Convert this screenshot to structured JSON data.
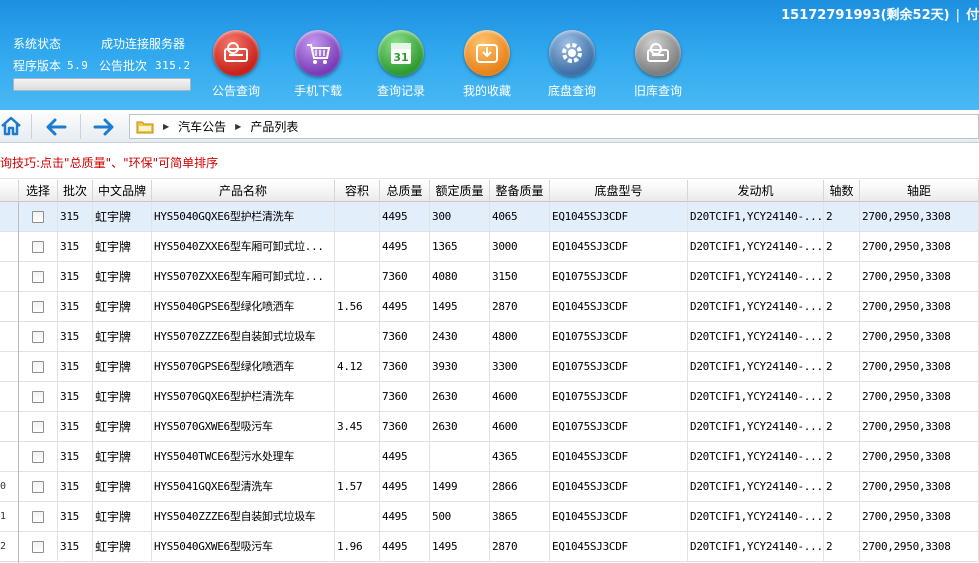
{
  "header": {
    "account": "15172791993(剩余52天)",
    "separator": "|",
    "account_extra": "付",
    "status": {
      "label1": "系统状态",
      "value1": "成功连接服务器",
      "label2": "程序版本",
      "version": "5.9",
      "label3": "公告批次",
      "batch": "315.2"
    },
    "progress": 1.0,
    "toolbar": [
      {
        "label": "公告查询",
        "icon": "announcement-search-icon",
        "color": "#d8342c"
      },
      {
        "label": "手机下载",
        "icon": "cart-download-icon",
        "color": "#8a4cc0"
      },
      {
        "label": "查询记录",
        "icon": "calendar-record-icon",
        "color": "#3aa63a"
      },
      {
        "label": "我的收藏",
        "icon": "favorites-inbox-icon",
        "color": "#f08c1c"
      },
      {
        "label": "底盘查询",
        "icon": "gear-chassis-icon",
        "color": "#4d7fb4"
      },
      {
        "label": "旧库查询",
        "icon": "old-archive-icon",
        "color": "#8c8c8c"
      }
    ],
    "calendar_day": "31"
  },
  "nav": {
    "crumbs": [
      "汽车公告",
      "产品列表"
    ]
  },
  "tip": "询技巧:点击\"总质量\"、\"环保\"可简单排序",
  "grid": {
    "columns": [
      "选择",
      "批次",
      "中文品牌",
      "产品名称",
      "容积",
      "总质量",
      "额定质量",
      "整备质量",
      "底盘型号",
      "发动机",
      "轴数",
      "轴距"
    ],
    "gutter": [
      "",
      "",
      "",
      "",
      "",
      "",
      "",
      "",
      "",
      "0",
      "1",
      "2"
    ],
    "rows": [
      [
        "315",
        "虹宇牌",
        "HYS5040GQXE6型护栏清洗车",
        "",
        "4495",
        "300",
        "4065",
        "EQ1045SJ3CDF",
        "D20TCIF1,YCY24140-...",
        "2",
        "2700,2950,3308"
      ],
      [
        "315",
        "虹宇牌",
        "HYS5040ZXXE6型车厢可卸式垃...",
        "",
        "4495",
        "1365",
        "3000",
        "EQ1045SJ3CDF",
        "D20TCIF1,YCY24140-...",
        "2",
        "2700,2950,3308"
      ],
      [
        "315",
        "虹宇牌",
        "HYS5070ZXXE6型车厢可卸式垃...",
        "",
        "7360",
        "4080",
        "3150",
        "EQ1075SJ3CDF",
        "D20TCIF1,YCY24140-...",
        "2",
        "2700,2950,3308"
      ],
      [
        "315",
        "虹宇牌",
        "HYS5040GPSE6型绿化喷洒车",
        "1.56",
        "4495",
        "1495",
        "2870",
        "EQ1045SJ3CDF",
        "D20TCIF1,YCY24140-...",
        "2",
        "2700,2950,3308"
      ],
      [
        "315",
        "虹宇牌",
        "HYS5070ZZZE6型自装卸式垃圾车",
        "",
        "7360",
        "2430",
        "4800",
        "EQ1075SJ3CDF",
        "D20TCIF1,YCY24140-...",
        "2",
        "2700,2950,3308"
      ],
      [
        "315",
        "虹宇牌",
        "HYS5070GPSE6型绿化喷洒车",
        "4.12",
        "7360",
        "3930",
        "3300",
        "EQ1075SJ3CDF",
        "D20TCIF1,YCY24140-...",
        "2",
        "2700,2950,3308"
      ],
      [
        "315",
        "虹宇牌",
        "HYS5070GQXE6型护栏清洗车",
        "",
        "7360",
        "2630",
        "4600",
        "EQ1075SJ3CDF",
        "D20TCIF1,YCY24140-...",
        "2",
        "2700,2950,3308"
      ],
      [
        "315",
        "虹宇牌",
        "HYS5070GXWE6型吸污车",
        "3.45",
        "7360",
        "2630",
        "4600",
        "EQ1075SJ3CDF",
        "D20TCIF1,YCY24140-...",
        "2",
        "2700,2950,3308"
      ],
      [
        "315",
        "虹宇牌",
        "HYS5040TWCE6型污水处理车",
        "",
        "4495",
        "",
        "4365",
        "EQ1045SJ3CDF",
        "D20TCIF1,YCY24140-...",
        "2",
        "2700,2950,3308"
      ],
      [
        "315",
        "虹宇牌",
        "HYS5041GQXE6型清洗车",
        "1.57",
        "4495",
        "1499",
        "2866",
        "EQ1045SJ3CDF",
        "D20TCIF1,YCY24140-...",
        "2",
        "2700,2950,3308"
      ],
      [
        "315",
        "虹宇牌",
        "HYS5040ZZZE6型自装卸式垃圾车",
        "",
        "4495",
        "500",
        "3865",
        "EQ1045SJ3CDF",
        "D20TCIF1,YCY24140-...",
        "2",
        "2700,2950,3308"
      ],
      [
        "315",
        "虹宇牌",
        "HYS5040GXWE6型吸污车",
        "1.96",
        "4495",
        "1495",
        "2870",
        "EQ1045SJ3CDF",
        "D20TCIF1,YCY24140-...",
        "2",
        "2700,2950,3308"
      ]
    ]
  }
}
